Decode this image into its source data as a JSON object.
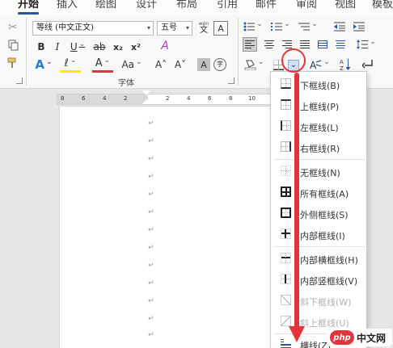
{
  "menubar": {
    "tabs": [
      "开始",
      "插入",
      "绘图",
      "设计",
      "布局",
      "引用",
      "邮件",
      "审阅",
      "视图",
      "模板"
    ],
    "active": 0
  },
  "ribbon": {
    "font_name": "等线 (中文正文)",
    "font_size": "五号",
    "wen_label": "wén",
    "wen_char": "文",
    "a_box": "A",
    "bold": "B",
    "italic": "I",
    "underline": "U",
    "strike": "ab",
    "subscript": "x₂",
    "superscript": "x²",
    "clear_format": "A",
    "text_effect": "A",
    "highlight": "ℓ",
    "font_color": "A",
    "change_case": "Aa",
    "grow_font": "A˄",
    "shrink_font": "A˅",
    "char_shading": "A",
    "enclose": "字",
    "font_group_label": "字体",
    "sort_label": "A↓Z",
    "highlight_color": "#ffea00",
    "font_color_bar": "#e5333b"
  },
  "ruler": {
    "numbers": [
      "8",
      "6",
      "4",
      "2",
      "2",
      "4",
      "6",
      "8",
      "10"
    ]
  },
  "doc": {
    "para_mark": "↵"
  },
  "menu": {
    "items": [
      {
        "label": "下框线(B)",
        "disabled": false
      },
      {
        "label": "上框线(P)",
        "disabled": false
      },
      {
        "label": "左框线(L)",
        "disabled": false
      },
      {
        "label": "右框线(R)",
        "disabled": false
      },
      {
        "label": "无框线(N)",
        "disabled": false
      },
      {
        "label": "所有框线(A)",
        "disabled": false
      },
      {
        "label": "外侧框线(S)",
        "disabled": false
      },
      {
        "label": "内部框线(I)",
        "disabled": false
      },
      {
        "label": "内部横框线(H)",
        "disabled": false
      },
      {
        "label": "内部竖框线(V)",
        "disabled": false
      },
      {
        "label": "斜下框线(W)",
        "disabled": true
      },
      {
        "label": "斜上框线(U)",
        "disabled": true
      },
      {
        "label": "横线(Z)",
        "disabled": false
      }
    ]
  },
  "watermark": {
    "logo": "php",
    "text": "中文网"
  },
  "colors": {
    "accent": "#2b579a",
    "annotation": "#e5333b"
  }
}
